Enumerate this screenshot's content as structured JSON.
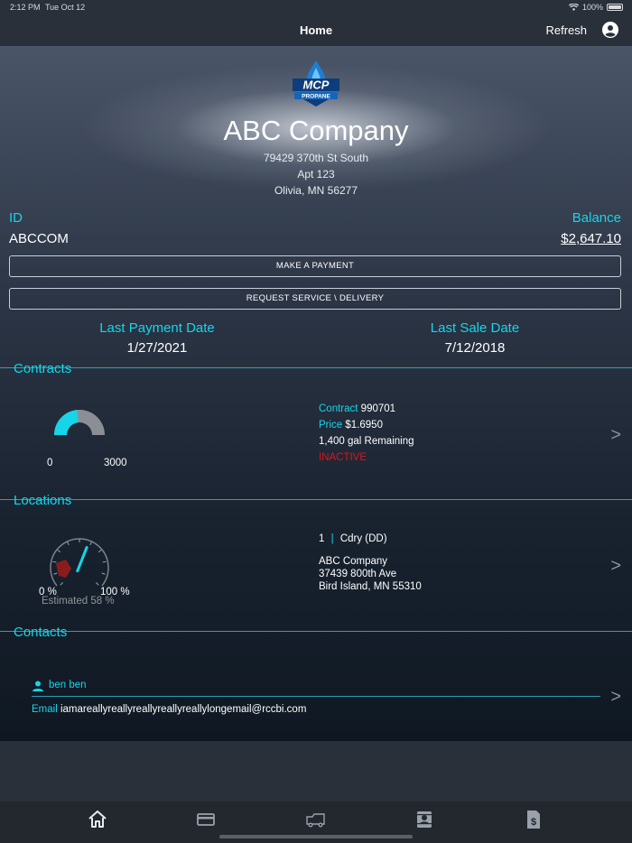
{
  "status": {
    "time": "2:12 PM",
    "date": "Tue Oct 12",
    "battery": "100%"
  },
  "nav": {
    "title": "Home",
    "refresh": "Refresh"
  },
  "logo": {
    "text": "MCP",
    "sub": "PROPANE"
  },
  "company": {
    "name": "ABC Company",
    "address1": "79429 370th St South",
    "address2": "Apt 123",
    "address3": "Olivia, MN 56277"
  },
  "account": {
    "id_label": "ID",
    "id_value": "ABCCOM",
    "balance_label": "Balance",
    "balance_value": "$2,647.10"
  },
  "buttons": {
    "payment": "MAKE A PAYMENT",
    "service": "REQUEST SERVICE \\ DELIVERY"
  },
  "dates": {
    "last_payment_label": "Last Payment Date",
    "last_payment_value": "1/27/2021",
    "last_sale_label": "Last Sale Date",
    "last_sale_value": "7/12/2018"
  },
  "contracts": {
    "title": "Contracts",
    "gauge_min": "0",
    "gauge_max": "3000",
    "gauge_fraction": 0.47,
    "contract_label": "Contract",
    "contract_value": "990701",
    "price_label": "Price",
    "price_value": "$1.6950",
    "remaining": "1,400 gal Remaining",
    "status": "INACTIVE"
  },
  "locations": {
    "title": "Locations",
    "gauge_min": "0 %",
    "gauge_max": "100 %",
    "estimated": "Estimated 58 %",
    "estimated_percent": 58,
    "number": "1",
    "separator": "|",
    "name": "Cdry",
    "code": "(DD)",
    "addr1": "ABC Company",
    "addr2": "37439 800th Ave",
    "addr3": "Bird Island, MN  55310"
  },
  "contacts": {
    "title": "Contacts",
    "name": "ben ben",
    "email_label": "Email",
    "email_value": "iamareallyreallyreallyreallyreallylongemail@rccbi.com"
  },
  "chevron": ">",
  "colors": {
    "accent": "#17d5e8",
    "inactive": "#e0141a",
    "gauge_red": "#8c1c1c"
  },
  "tabs": [
    "home-icon",
    "card-icon",
    "truck-icon",
    "contacts-icon",
    "invoice-icon"
  ]
}
